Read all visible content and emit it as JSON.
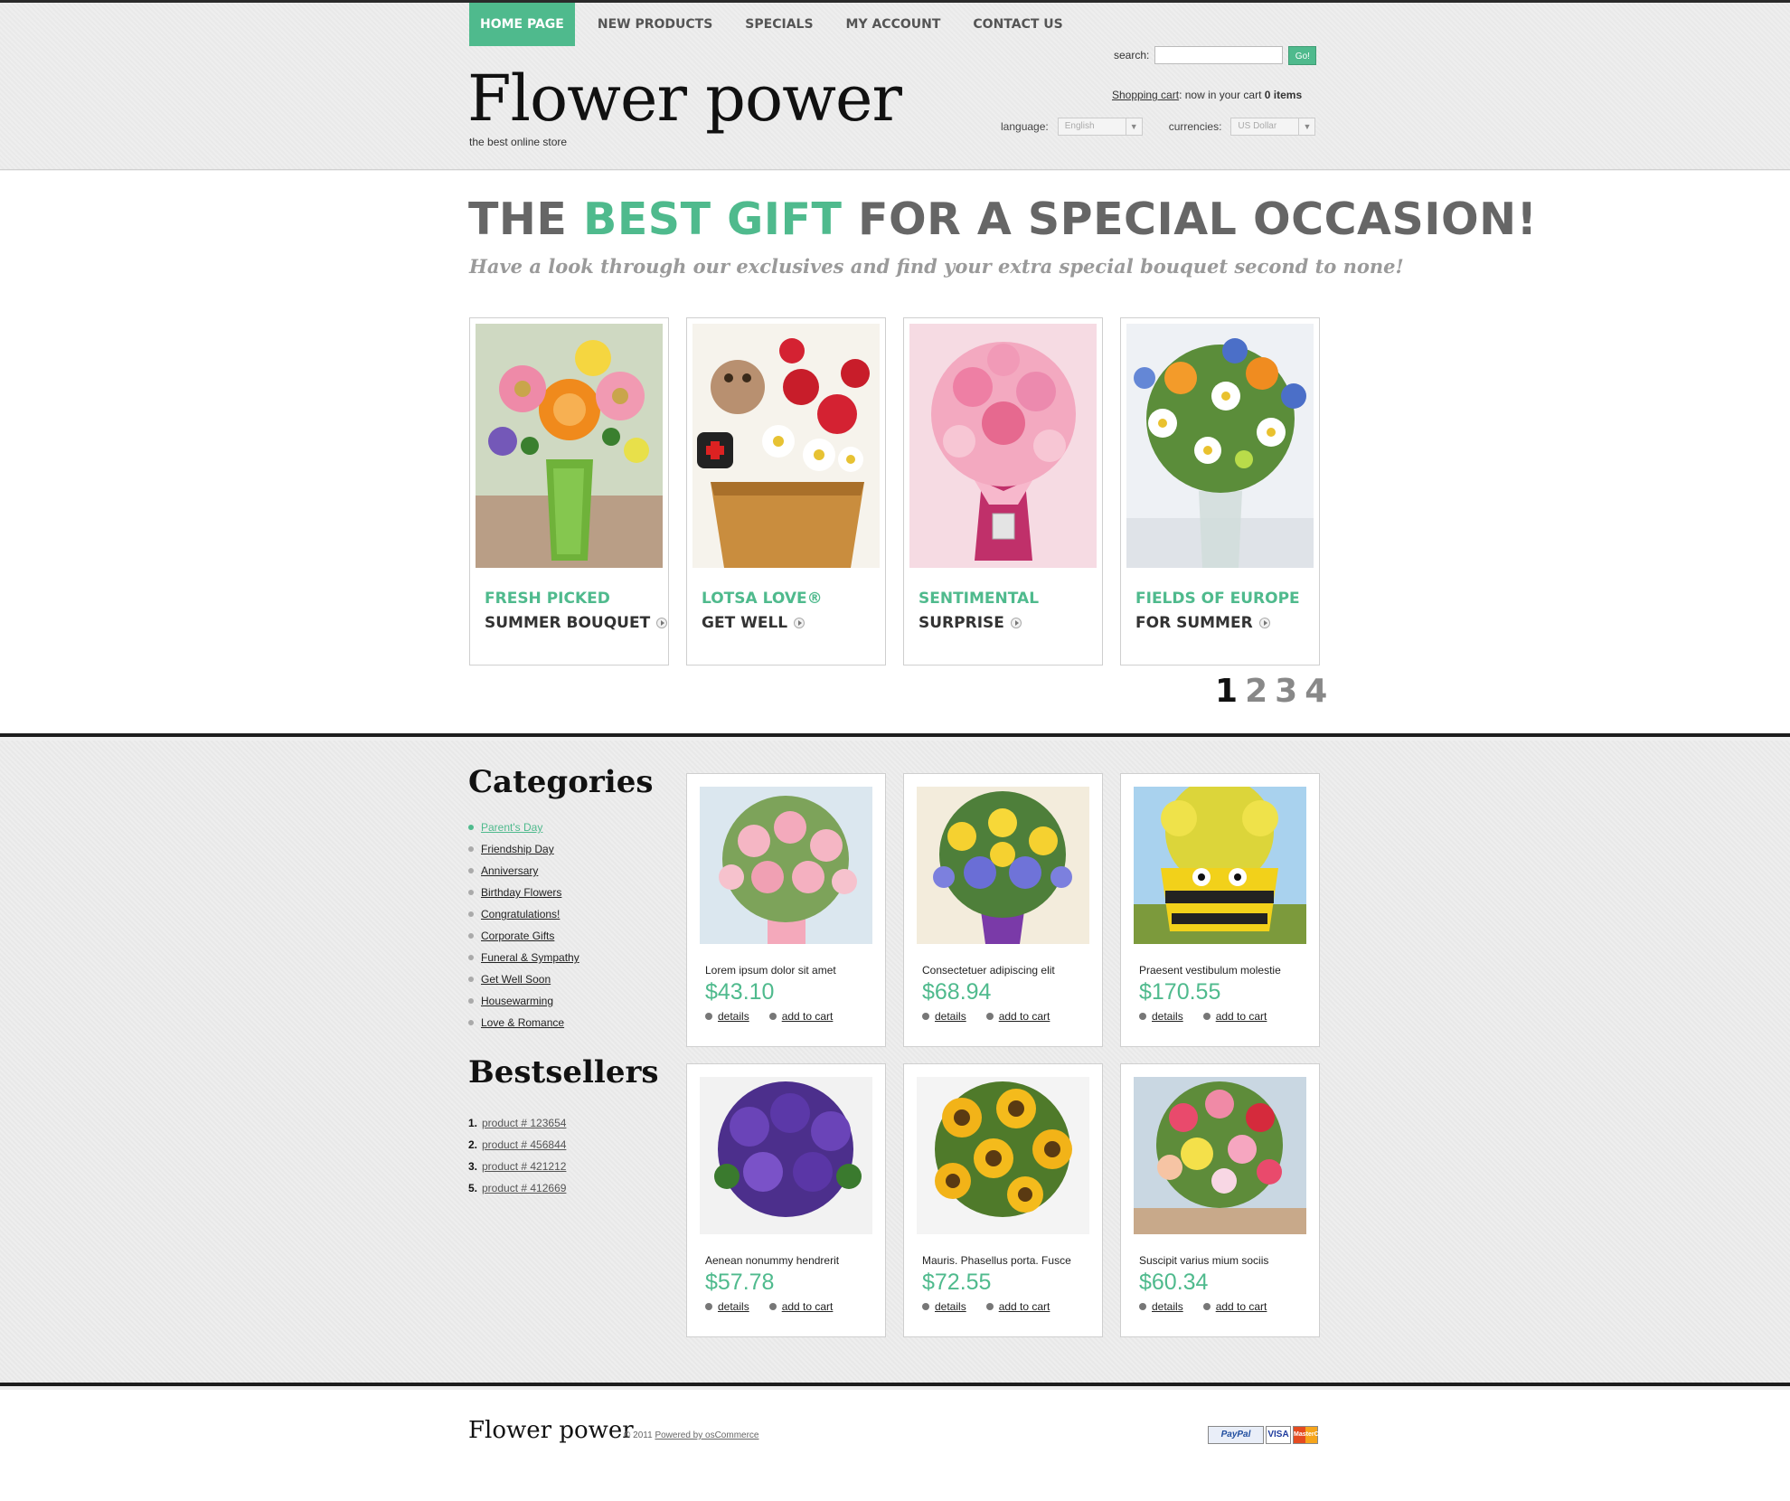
{
  "nav": {
    "items": [
      {
        "label": "HOME PAGE",
        "active": true
      },
      {
        "label": "NEW PRODUCTS",
        "active": false
      },
      {
        "label": "SPECIALS",
        "active": false
      },
      {
        "label": "MY ACCOUNT",
        "active": false
      },
      {
        "label": "CONTACT US",
        "active": false
      }
    ]
  },
  "search": {
    "label": "search:",
    "value": "",
    "button_label": "Go!"
  },
  "brand": {
    "logo": "Flower power",
    "tagline": "the best online store"
  },
  "cart": {
    "link_label": "Shopping cart",
    "text": ": now in your cart ",
    "count": "0 items"
  },
  "settings": {
    "language_label": "language:",
    "language_value": "English",
    "currencies_label": "currencies:",
    "currency_value": "US Dollar"
  },
  "hero": {
    "title_before": "THE ",
    "title_accent": "BEST GIFT",
    "title_after": " FOR A SPECIAL OCCASION!",
    "subtitle": "Have a look through our exclusives and find your extra special bouquet second to none!",
    "features": [
      {
        "line1": "FRESH PICKED",
        "line2": "SUMMER BOUQUET"
      },
      {
        "line1": "LOTSA LOVE®",
        "line2": "GET WELL"
      },
      {
        "line1": "SENTIMENTAL",
        "line2": "SURPRISE"
      },
      {
        "line1": "FIELDS OF EUROPE",
        "line2": "FOR SUMMER"
      }
    ],
    "pager": [
      "1",
      "2",
      "3",
      "4"
    ],
    "pager_active": "1"
  },
  "sidebar": {
    "categories_heading": "Categories",
    "categories": [
      "Parent's Day",
      "Friendship Day",
      "Anniversary",
      "Birthday Flowers",
      "Congratulations!",
      "Corporate Gifts",
      "Funeral & Sympathy",
      "Get Well Soon",
      "Housewarming",
      "Love & Romance"
    ],
    "active_category": "Parent's Day",
    "bestsellers_heading": "Bestsellers",
    "bestsellers": [
      {
        "rank": "1.",
        "label": "product # 123654"
      },
      {
        "rank": "2.",
        "label": "product # 456844"
      },
      {
        "rank": "3.",
        "label": "product # 421212"
      },
      {
        "rank": "5.",
        "label": "product # 412669"
      }
    ]
  },
  "products": [
    {
      "name": "Lorem ipsum dolor sit amet",
      "price": "$43.10"
    },
    {
      "name": "Consectetuer adipiscing elit",
      "price": "$68.94"
    },
    {
      "name": "Praesent vestibulum molestie",
      "price": "$170.55"
    },
    {
      "name": "Aenean nonummy hendrerit",
      "price": "$57.78"
    },
    {
      "name": "Mauris. Phasellus porta. Fusce",
      "price": "$72.55"
    },
    {
      "name": "Suscipit varius mium sociis",
      "price": "$60.34"
    }
  ],
  "product_actions": {
    "details": "details",
    "add_to_cart": "add to cart"
  },
  "footer": {
    "logo": "Flower power",
    "copyright": "© 2011 ",
    "powered_by": "Powered by osCommerce",
    "payment": {
      "paypal": "PayPal",
      "visa": "VISA",
      "mastercard": "MasterCard"
    }
  },
  "colors": {
    "accent": "#4fba8d",
    "dark": "#1e1e1e"
  }
}
